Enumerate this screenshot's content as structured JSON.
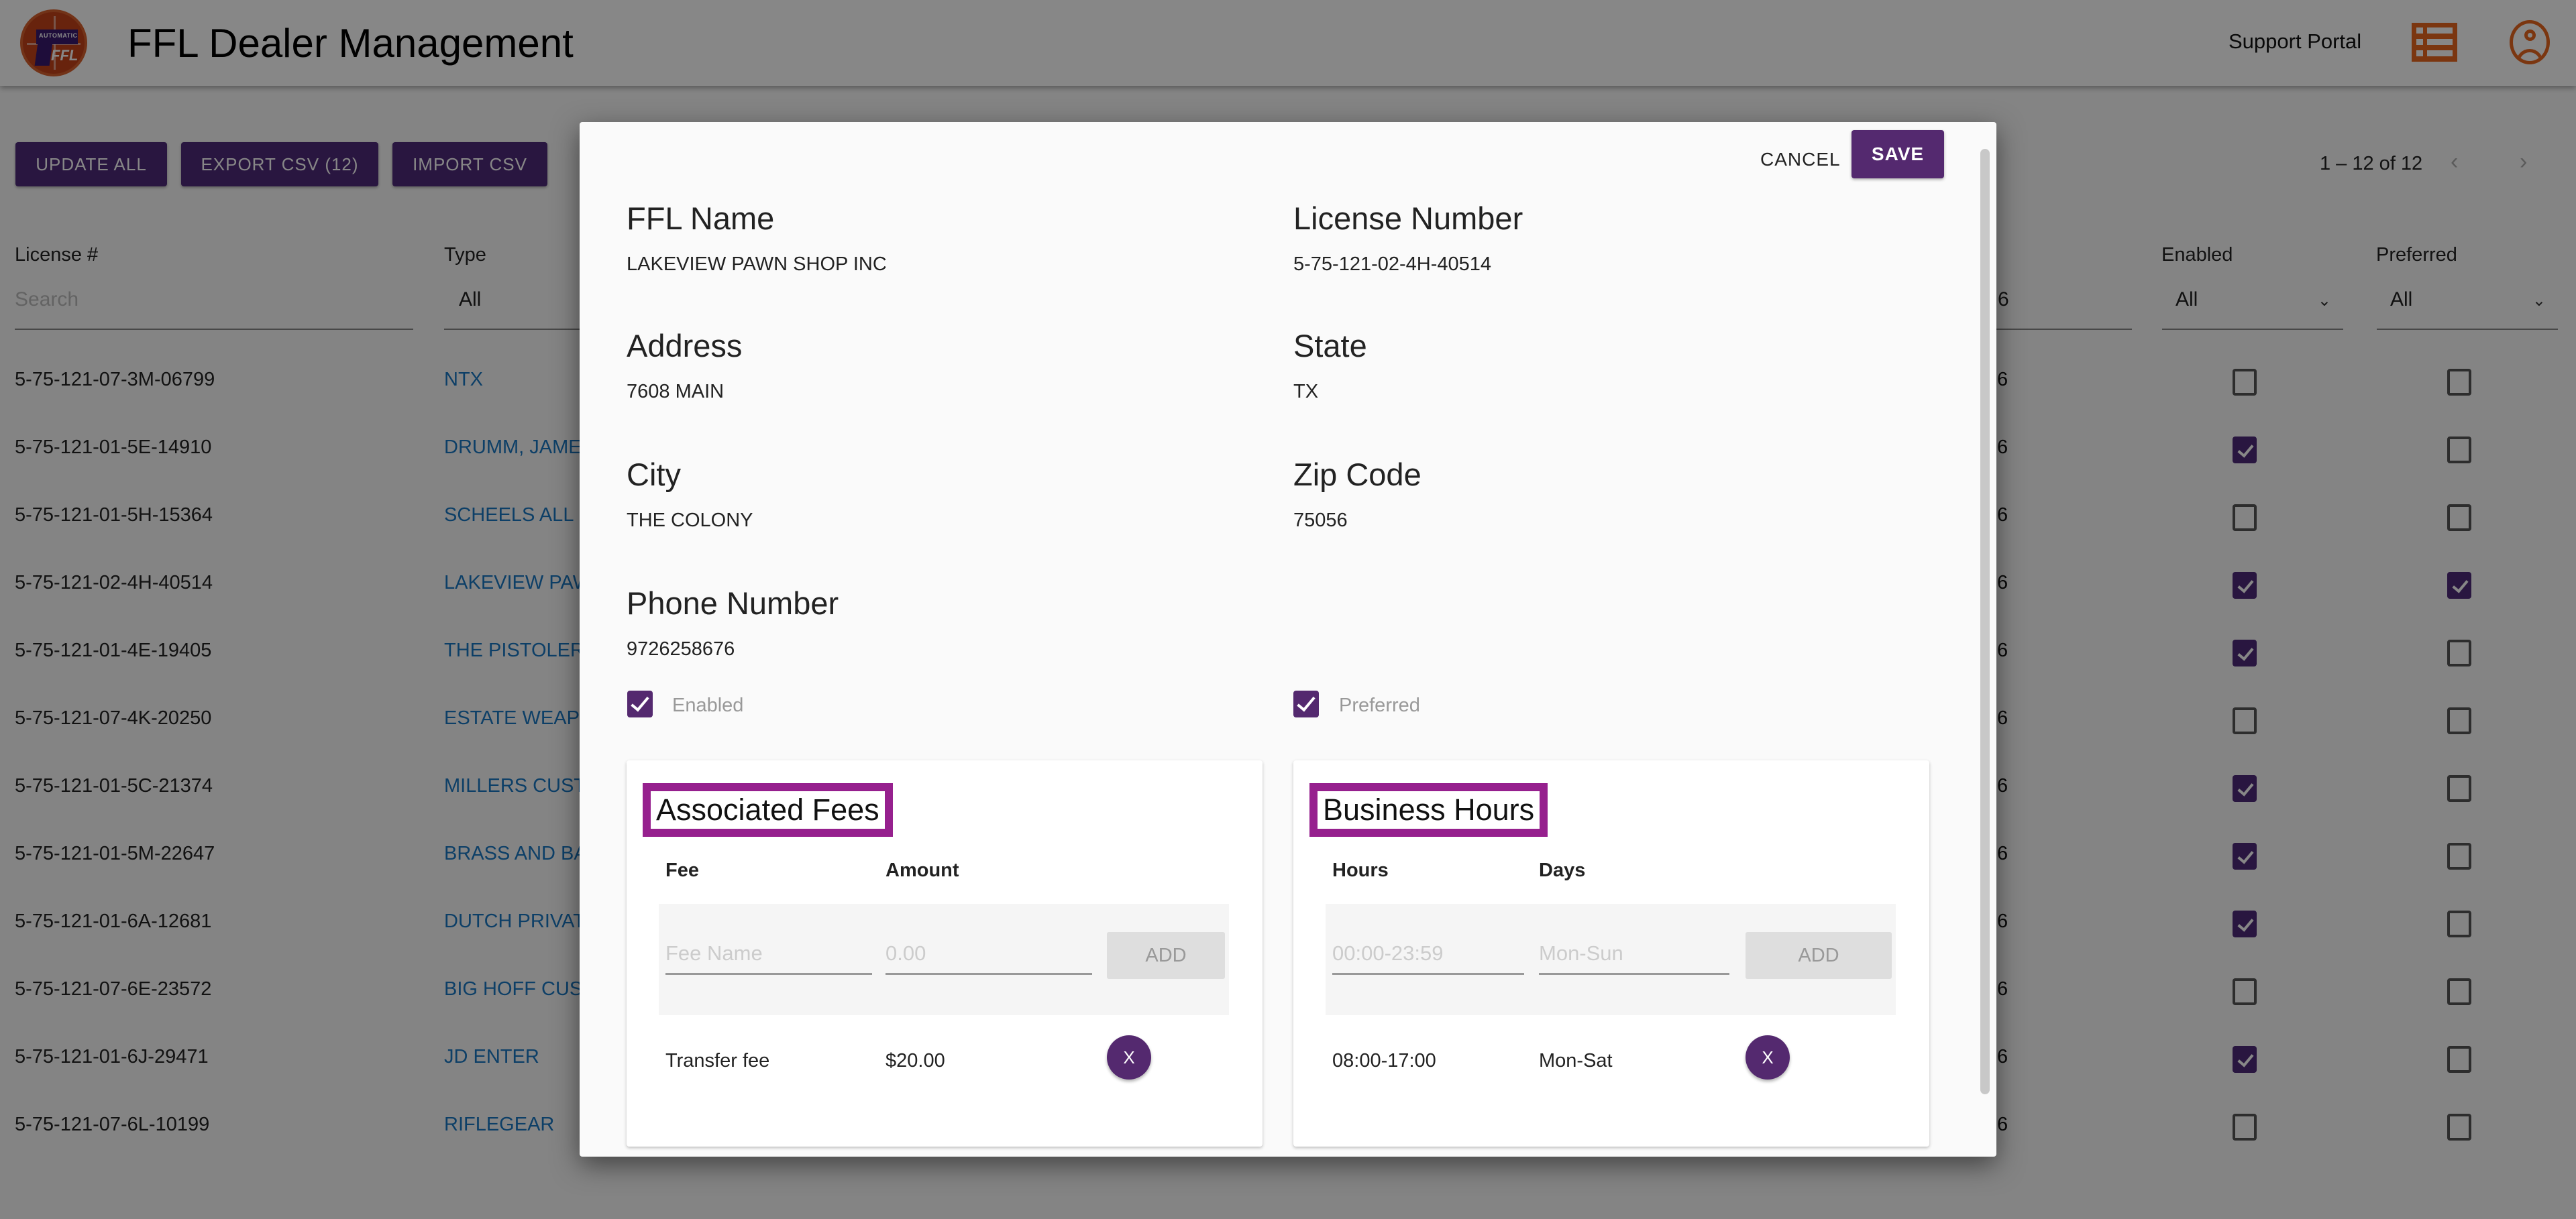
{
  "header": {
    "title": "FFL Dealer Management",
    "logo_text_top": "AUTOMATIC",
    "logo_text_bottom": "FFL",
    "support_link": "Support Portal",
    "icons": [
      "list-icon",
      "account-circle-icon"
    ],
    "accent_color": "#e8661f"
  },
  "toolbar": {
    "update_all": "UPDATE ALL",
    "export_csv": "EXPORT CSV (12)",
    "import_csv": "IMPORT CSV",
    "button_color": "#4f2a7a"
  },
  "pagination": {
    "range": "1 – 12 of 12",
    "prev": "‹",
    "next": "›"
  },
  "table": {
    "columns": {
      "license": "License #",
      "type": "Type",
      "enabled": "Enabled",
      "preferred": "Preferred"
    },
    "filters": {
      "license_placeholder": "Search",
      "type_value": "All",
      "partial_column_value": "6",
      "enabled_value": "All",
      "preferred_value": "All"
    },
    "rows": [
      {
        "license": "5-75-121-07-3M-06799",
        "type": "NTX",
        "partial": "6",
        "enabled": false,
        "preferred": false
      },
      {
        "license": "5-75-121-01-5E-14910",
        "type": "DRUMM, JAME",
        "partial": "6",
        "enabled": true,
        "preferred": false
      },
      {
        "license": "5-75-121-01-5H-15364",
        "type": "SCHEELS ALL",
        "partial": "6",
        "enabled": false,
        "preferred": false
      },
      {
        "license": "5-75-121-02-4H-40514",
        "type": "LAKEVIEW PAW",
        "partial": "6",
        "enabled": true,
        "preferred": true
      },
      {
        "license": "5-75-121-01-4E-19405",
        "type": "THE PISTOLER",
        "partial": "6",
        "enabled": true,
        "preferred": false
      },
      {
        "license": "5-75-121-07-4K-20250",
        "type": "ESTATE WEAP",
        "partial": "6",
        "enabled": false,
        "preferred": false
      },
      {
        "license": "5-75-121-01-5C-21374",
        "type": "MILLERS CUST",
        "partial": "6",
        "enabled": true,
        "preferred": false
      },
      {
        "license": "5-75-121-01-5M-22647",
        "type": "BRASS AND BA",
        "partial": "6",
        "enabled": true,
        "preferred": false
      },
      {
        "license": "5-75-121-01-6A-12681",
        "type": "DUTCH PRIVAT",
        "partial": "6",
        "enabled": true,
        "preferred": false
      },
      {
        "license": "5-75-121-07-6E-23572",
        "type": "BIG HOFF CUS",
        "partial": "6",
        "enabled": false,
        "preferred": false
      },
      {
        "license": "5-75-121-01-6J-29471",
        "type": "JD ENTER",
        "partial": "6",
        "enabled": true,
        "preferred": false
      },
      {
        "license": "5-75-121-07-6L-10199",
        "type": "RIFLEGEAR",
        "partial": "6",
        "enabled": false,
        "preferred": false
      }
    ]
  },
  "modal": {
    "cancel": "CANCEL",
    "save": "SAVE",
    "fields": {
      "ffl_name_label": "FFL Name",
      "ffl_name": "LAKEVIEW PAWN SHOP INC",
      "license_label": "License Number",
      "license": "5-75-121-02-4H-40514",
      "address_label": "Address",
      "address": "7608 MAIN",
      "state_label": "State",
      "state": "TX",
      "city_label": "City",
      "city": "THE COLONY",
      "zip_label": "Zip Code",
      "zip": "75056",
      "phone_label": "Phone Number",
      "phone": "9726258676"
    },
    "enabled_label": "Enabled",
    "enabled": true,
    "preferred_label": "Preferred",
    "preferred": true,
    "fees": {
      "title": "Associated Fees",
      "col_fee": "Fee",
      "col_amount": "Amount",
      "fee_name_placeholder": "Fee Name",
      "amount_placeholder": "0.00",
      "add": "ADD",
      "items": [
        {
          "name": "Transfer fee",
          "amount": "$20.00",
          "remove": "X"
        }
      ]
    },
    "hours": {
      "title": "Business Hours",
      "col_hours": "Hours",
      "col_days": "Days",
      "hours_placeholder": "00:00-23:59",
      "days_placeholder": "Mon-Sun",
      "add": "ADD",
      "items": [
        {
          "hours": "08:00-17:00",
          "days": "Mon-Sat",
          "remove": "X"
        }
      ]
    },
    "highlight_color": "#96208e",
    "primary_color": "#54296f"
  }
}
